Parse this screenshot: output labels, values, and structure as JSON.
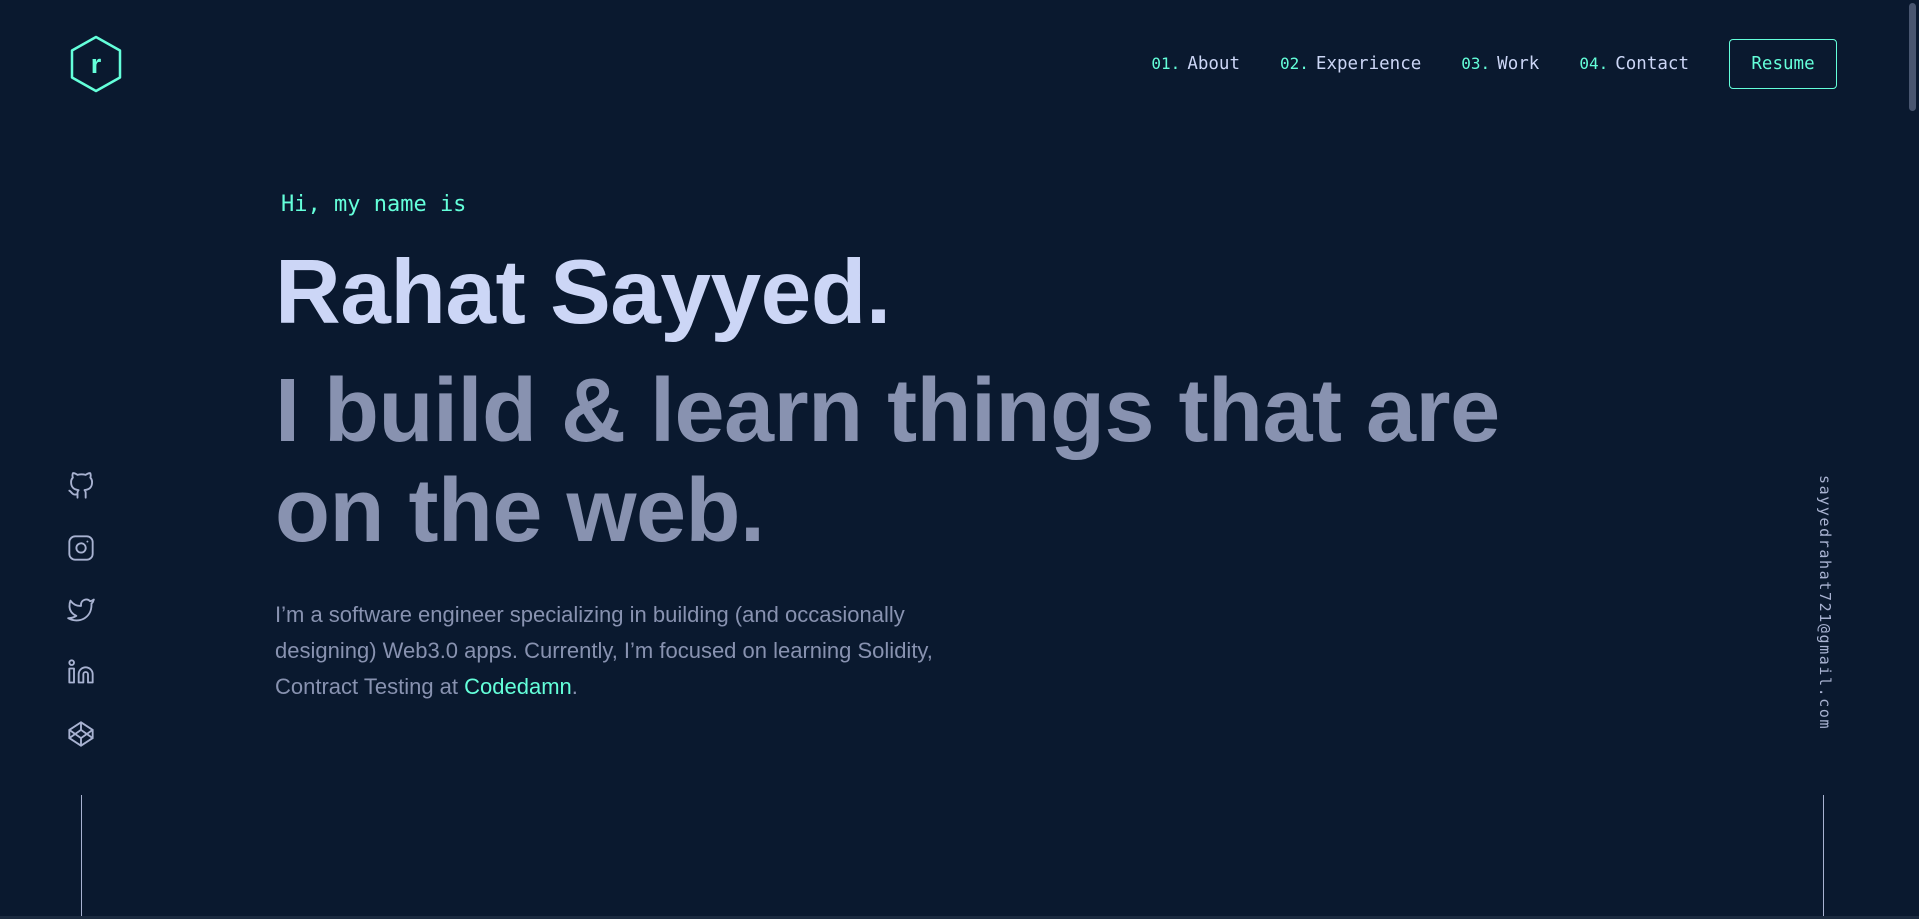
{
  "header": {
    "logo": {
      "icon": "hexagon-r-logo-icon",
      "letter": "r",
      "color": "#64ffda"
    },
    "nav": [
      {
        "num": "01.",
        "label": "About"
      },
      {
        "num": "02.",
        "label": "Experience"
      },
      {
        "num": "03.",
        "label": "Work"
      },
      {
        "num": "04.",
        "label": "Contact"
      }
    ],
    "resume_label": "Resume"
  },
  "hero": {
    "intro": "Hi, my name is",
    "name": "Rahat Sayyed.",
    "tagline": "I build & learn things that are on the web.",
    "description_prefix": "I’m a software engineer specializing in building (and occasionally designing) Web3.0 apps. Currently, I’m focused on learning Solidity, Contract Testing at ",
    "description_link": "Codedamn",
    "description_suffix": "."
  },
  "socials": [
    {
      "name": "github",
      "icon": "github-icon"
    },
    {
      "name": "instagram",
      "icon": "instagram-icon"
    },
    {
      "name": "twitter",
      "icon": "twitter-icon"
    },
    {
      "name": "linkedin",
      "icon": "linkedin-icon"
    },
    {
      "name": "codepen",
      "icon": "codepen-icon"
    }
  ],
  "email": "sayyedrahat721@gmail.com",
  "colors": {
    "background": "#0a192f",
    "accent": "#64ffda",
    "heading": "#ccd6f6",
    "text": "#8892b0",
    "light": "#a8b2d1"
  }
}
